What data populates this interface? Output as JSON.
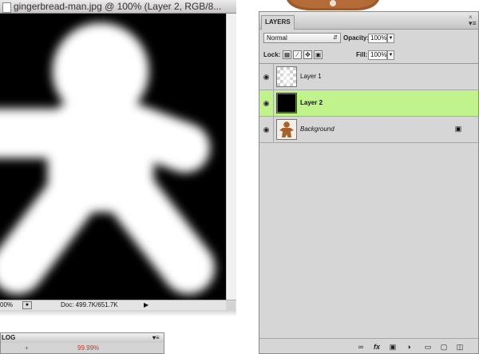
{
  "document": {
    "title": "gingerbread-man.jpg @ 100% (Layer 2, RGB/8...",
    "zoom": "00%",
    "doc_size": "Doc: 499.7K/651.7K"
  },
  "bottom_panel": {
    "tab": "LOG",
    "row_left": "+",
    "row_right": "99.99%"
  },
  "layers_panel": {
    "tab": "LAYERS",
    "close_icon": "close-icon",
    "menu_icon": "panel-menu-icon",
    "blend_mode": "Normal",
    "opacity_label": "Opacity:",
    "opacity_value": "100%",
    "lock_label": "Lock:",
    "fill_label": "Fill:",
    "fill_value": "100%",
    "lock_icons": [
      "lock-transparent-icon",
      "lock-paint-icon",
      "lock-move-icon",
      "lock-all-icon"
    ],
    "layers": [
      {
        "name": "Layer 1",
        "thumb": "transparent",
        "selected": false,
        "locked": false
      },
      {
        "name": "Layer 2",
        "thumb": "black-mask",
        "selected": true,
        "locked": false
      },
      {
        "name": "Background",
        "thumb": "gingerbread",
        "selected": false,
        "locked": true
      }
    ],
    "selected_color": "#c1f38d",
    "footer_icons": [
      "link-icon",
      "fx-icon",
      "mask-icon",
      "adjustment-icon",
      "group-folder-icon",
      "new-layer-icon",
      "trash-icon"
    ]
  }
}
